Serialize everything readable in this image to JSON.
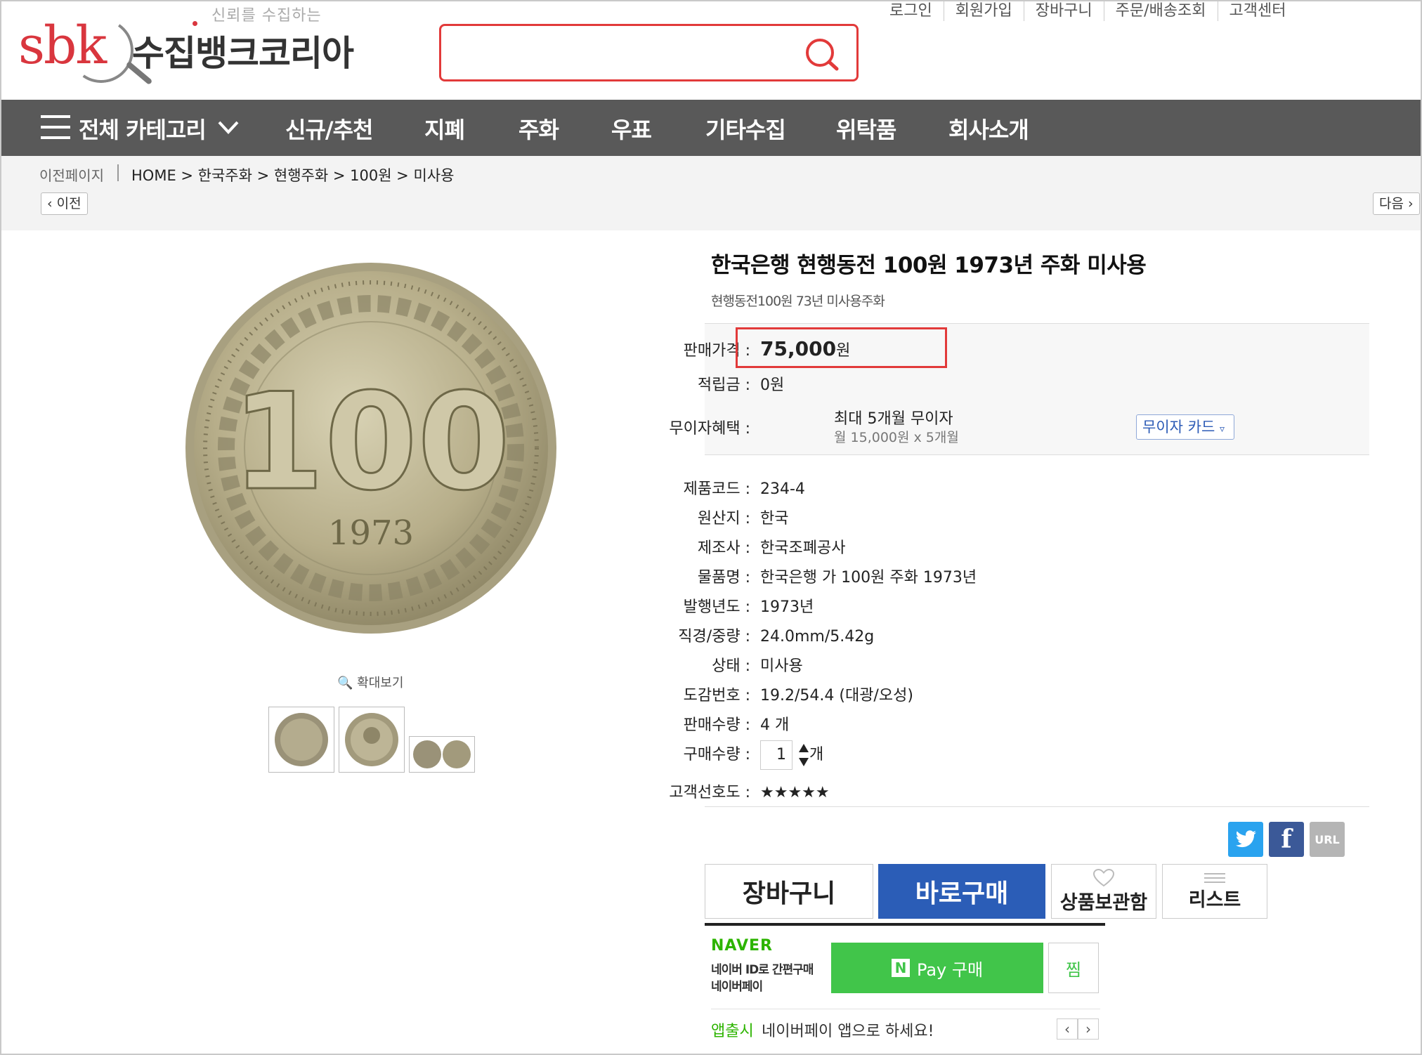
{
  "header": {
    "tagline": "신뢰를 수집하는",
    "logo_text": "sbk",
    "brand_name": "수집뱅크코리아",
    "search_placeholder": "",
    "top_links": [
      "로그인",
      "회원가입",
      "장바구니",
      "주문/배송조회",
      "고객센터"
    ]
  },
  "nav": {
    "all_category": "전체 카테고리",
    "items": [
      "신규/추천",
      "지폐",
      "주화",
      "우표",
      "기타수집",
      "위탁품",
      "회사소개"
    ]
  },
  "breadcrumb": {
    "prev_page": "이전페이지",
    "path": "HOME > 한국주화 > 현행주화 > 100원 > 미사용",
    "prev_btn": "이전",
    "next_btn": "다음"
  },
  "gallery": {
    "zoom_label": "확대보기",
    "coin_text": "100",
    "coin_year": "1973"
  },
  "product": {
    "title": "한국은행 현행동전 100원 1973년 주화 미사용",
    "subtitle": "현행동전100원 73년 미사용주화",
    "price_label": "판매가격",
    "price_value": "75,000",
    "price_unit": "원",
    "points_label": "적립금",
    "points_value": "0원",
    "installment_label": "무이자혜택",
    "installment_value": "최대 5개월 무이자",
    "installment_detail": "월 15,000원 x 5개월",
    "card_btn": "무이자 카드",
    "specs": [
      {
        "label": "제품코드",
        "value": "234-4"
      },
      {
        "label": "원산지",
        "value": "한국"
      },
      {
        "label": "제조사",
        "value": "한국조폐공사"
      },
      {
        "label": "물품명",
        "value": "한국은행 가 100원 주화 1973년"
      },
      {
        "label": "발행년도",
        "value": "1973년"
      },
      {
        "label": "직경/중량",
        "value": "24.0mm/5.42g"
      },
      {
        "label": "상태",
        "value": "미사용"
      },
      {
        "label": "도감번호",
        "value": "19.2/54.4 (대광/오성)"
      },
      {
        "label": "판매수량",
        "value": "4 개"
      }
    ],
    "qty_label": "구매수량",
    "qty_value": "1",
    "qty_unit": "개",
    "preference_label": "고객선호도",
    "preference_value": "★★★★★"
  },
  "share": {
    "url_label": "URL"
  },
  "actions": {
    "cart": "장바구니",
    "buy": "바로구매",
    "wishlist": "상품보관함",
    "list": "리스트"
  },
  "naver": {
    "logo": "NAVER",
    "line1": "네이버 ID로 간편구매",
    "line2": "네이버페이",
    "pay_n": "N",
    "pay_label": "Pay 구매",
    "jjim": "찜",
    "app_label": "앱출시",
    "app_msg": "네이버페이 앱으로 하세요!"
  },
  "colors": {
    "nav_bg": "#595959",
    "highlight": "#e23a3a",
    "buy_blue": "#2b5db7",
    "naver_green": "#41c54a"
  }
}
